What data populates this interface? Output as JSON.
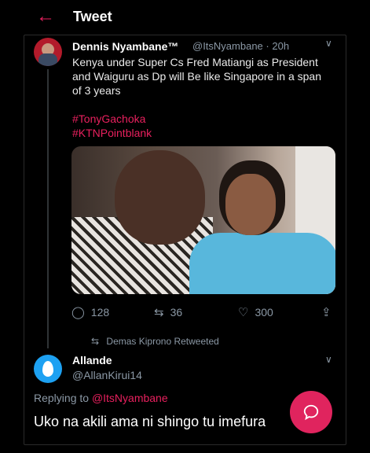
{
  "header": {
    "title": "Tweet"
  },
  "tweet": {
    "author_name": "Dennis Nyambane™",
    "author_handle": "@ItsNyambane",
    "time": "20h",
    "text": "Kenya under Super Cs Fred Matiangi as President and Waiguru as Dp will Be like Singapore in a span of 3 years",
    "hashtags": [
      "#TonyGachoka",
      "#KTNPointblank"
    ],
    "replies": "128",
    "retweets": "36",
    "likes": "300",
    "retweeted_by": "Demas Kiprono Retweeted"
  },
  "reply": {
    "name": "Allande",
    "handle": "@AllanKirui14",
    "replying_to_prefix": "Replying to",
    "replying_to_handle": "@ItsNyambane",
    "text": "Uko na akili ama ni shingo tu imefura"
  },
  "colors": {
    "accent": "#e8205e",
    "muted": "#8b98a5",
    "fab": "#e0245e"
  },
  "icons": [
    "back-arrow-icon",
    "chevron-down-icon",
    "reply-icon",
    "retweet-icon",
    "like-icon",
    "share-icon",
    "compose-icon"
  ]
}
